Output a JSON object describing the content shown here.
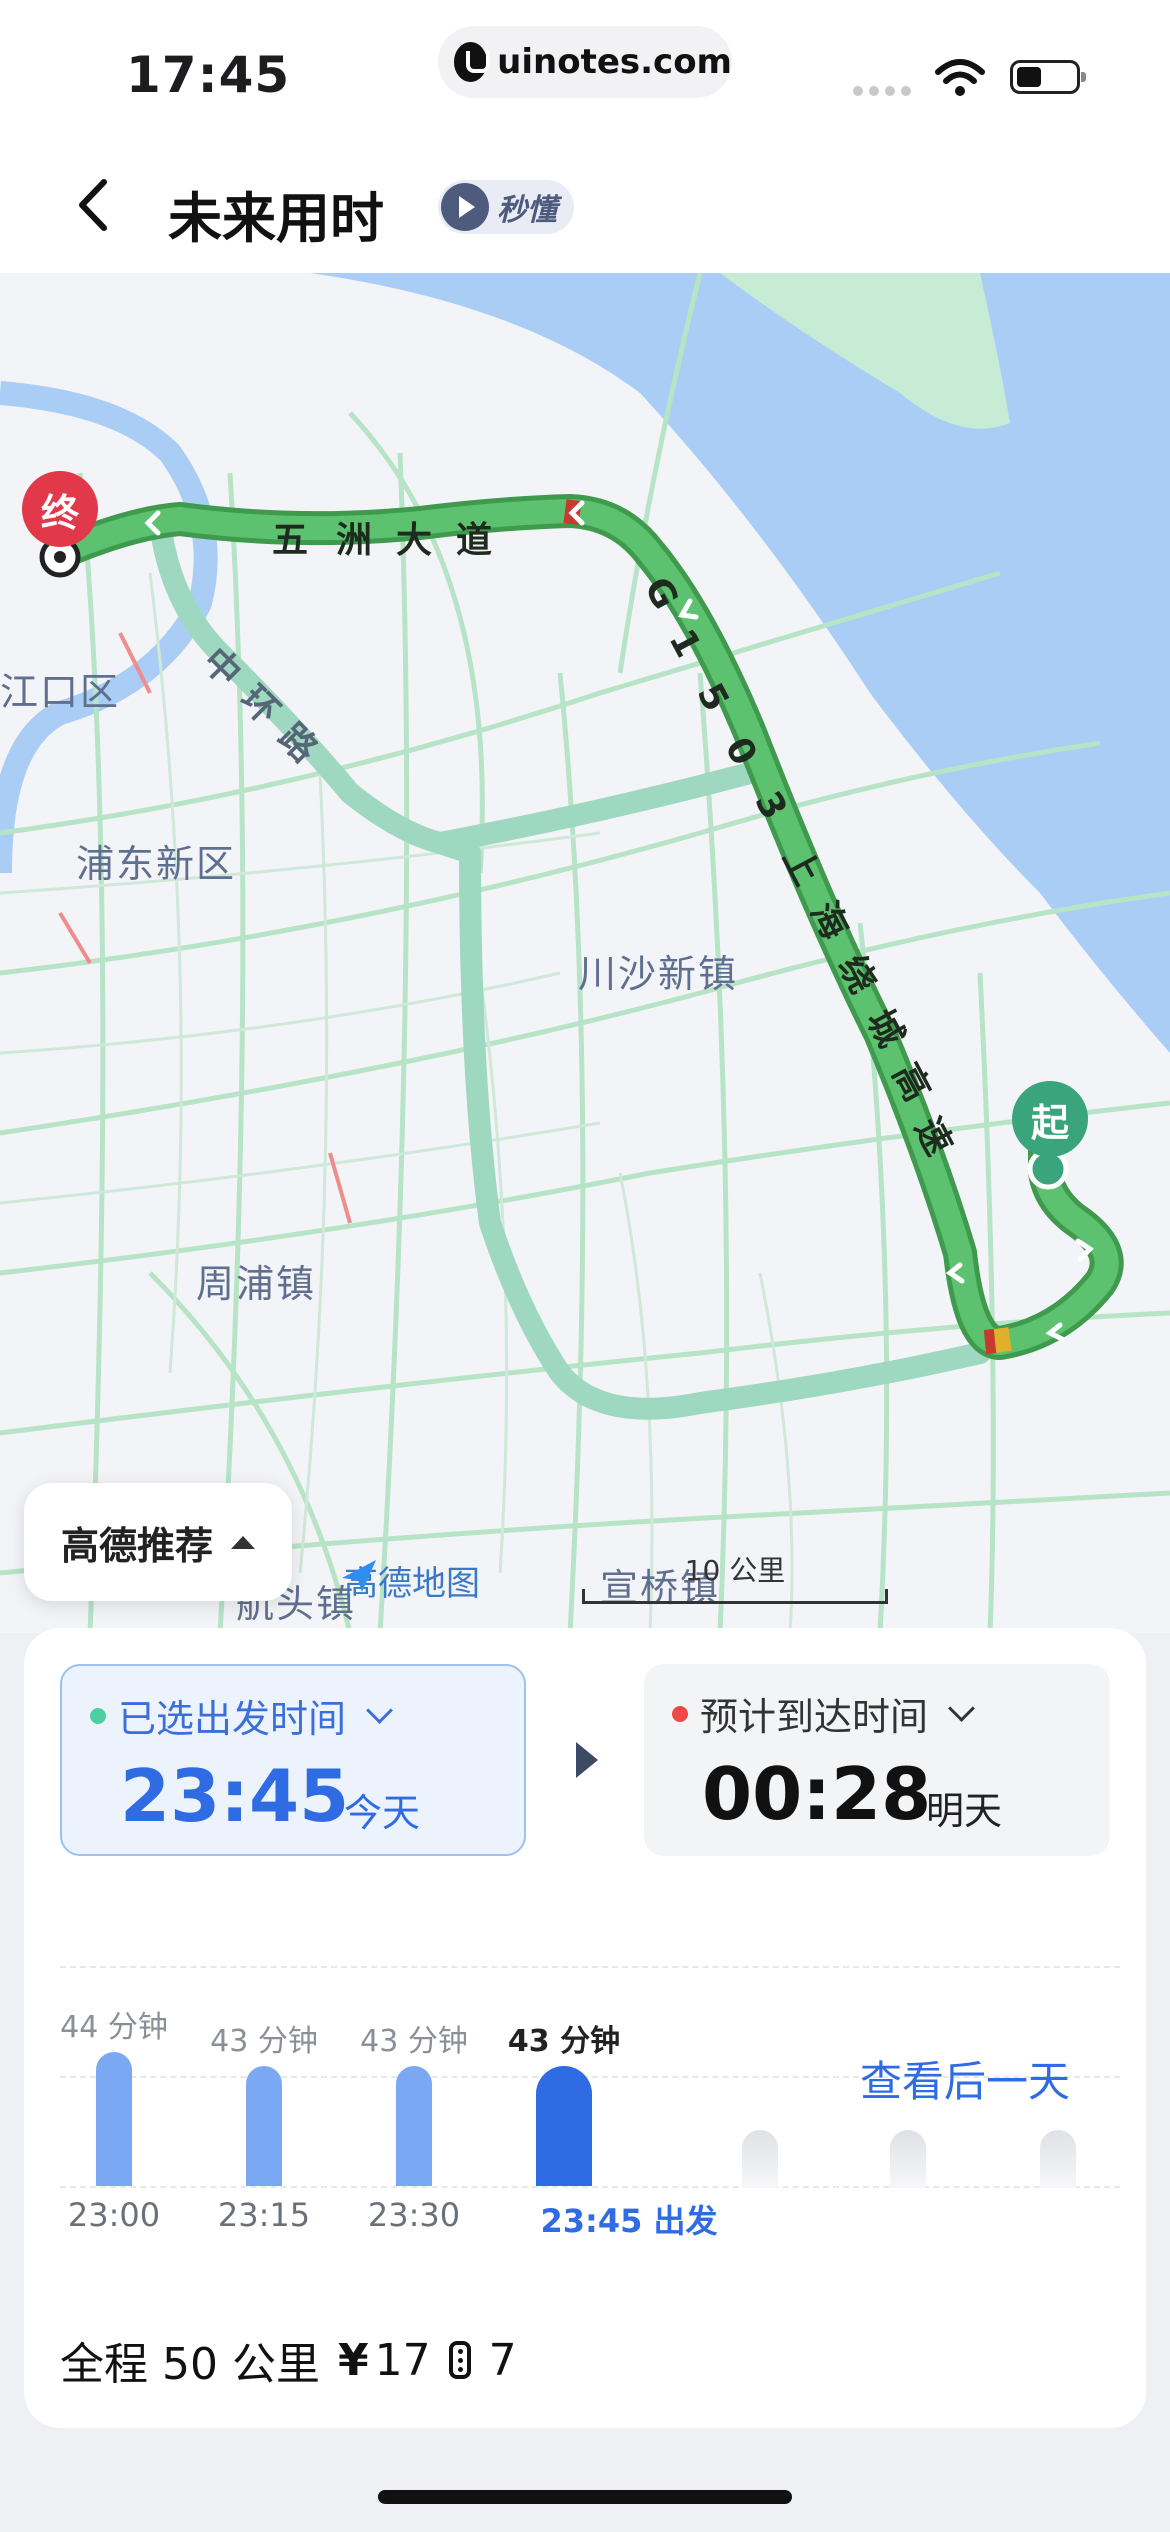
{
  "status_bar": {
    "time": "17:45",
    "url": "uinotes.com"
  },
  "header": {
    "back_icon": "chevron-left-icon",
    "title": "未来用时",
    "badge_label": "秒懂"
  },
  "map": {
    "road_labels": {
      "wuzhou_chars": [
        "五",
        "洲",
        "大",
        "道"
      ],
      "middle_ring_chars": [
        "中",
        "环",
        "路"
      ],
      "g1503_chars": [
        "G",
        "1",
        "5",
        "0",
        "3",
        "上",
        "海",
        "绕",
        "城",
        "高",
        "速"
      ]
    },
    "place_labels": {
      "district_edge": "江口区",
      "pudong": "浦东新区",
      "chuansha": "川沙新镇",
      "zhoupu": "周浦镇",
      "hangtou": "航头镇",
      "xuanqiao": "宣桥镇"
    },
    "start_pin": "起",
    "end_pin": "终",
    "recommend_label": "高德推荐",
    "logo_text": "高德地图",
    "scale_label": "10 公里",
    "colors": {
      "water": "#a9cdf5",
      "green_area": "#c7ecd5",
      "route": "#55b866",
      "alt_route": "#9fd8c0"
    }
  },
  "departure": {
    "label": "已选出发时间",
    "time": "23:45",
    "day": "今天"
  },
  "arrival": {
    "label": "预计到达时间",
    "time": "00:28",
    "day": "明天"
  },
  "duration_chart": {
    "bars": [
      {
        "time": "23:00",
        "duration": "44 分钟",
        "minutes": 44,
        "selected": false
      },
      {
        "time": "23:15",
        "duration": "43 分钟",
        "minutes": 43,
        "selected": false
      },
      {
        "time": "23:30",
        "duration": "43 分钟",
        "minutes": 43,
        "selected": false
      },
      {
        "time": "23:45 出发",
        "duration": "43 分钟",
        "minutes": 43,
        "selected": true
      }
    ],
    "next_day_label": "查看后一天",
    "colors": {
      "bar": "#7aa8f2",
      "selected": "#2f6be3"
    }
  },
  "summary": {
    "distance": "全程 50 公里",
    "cost_icon": "yen-icon",
    "cost": "17",
    "lights_icon": "traffic-light-icon",
    "lights": "7"
  }
}
